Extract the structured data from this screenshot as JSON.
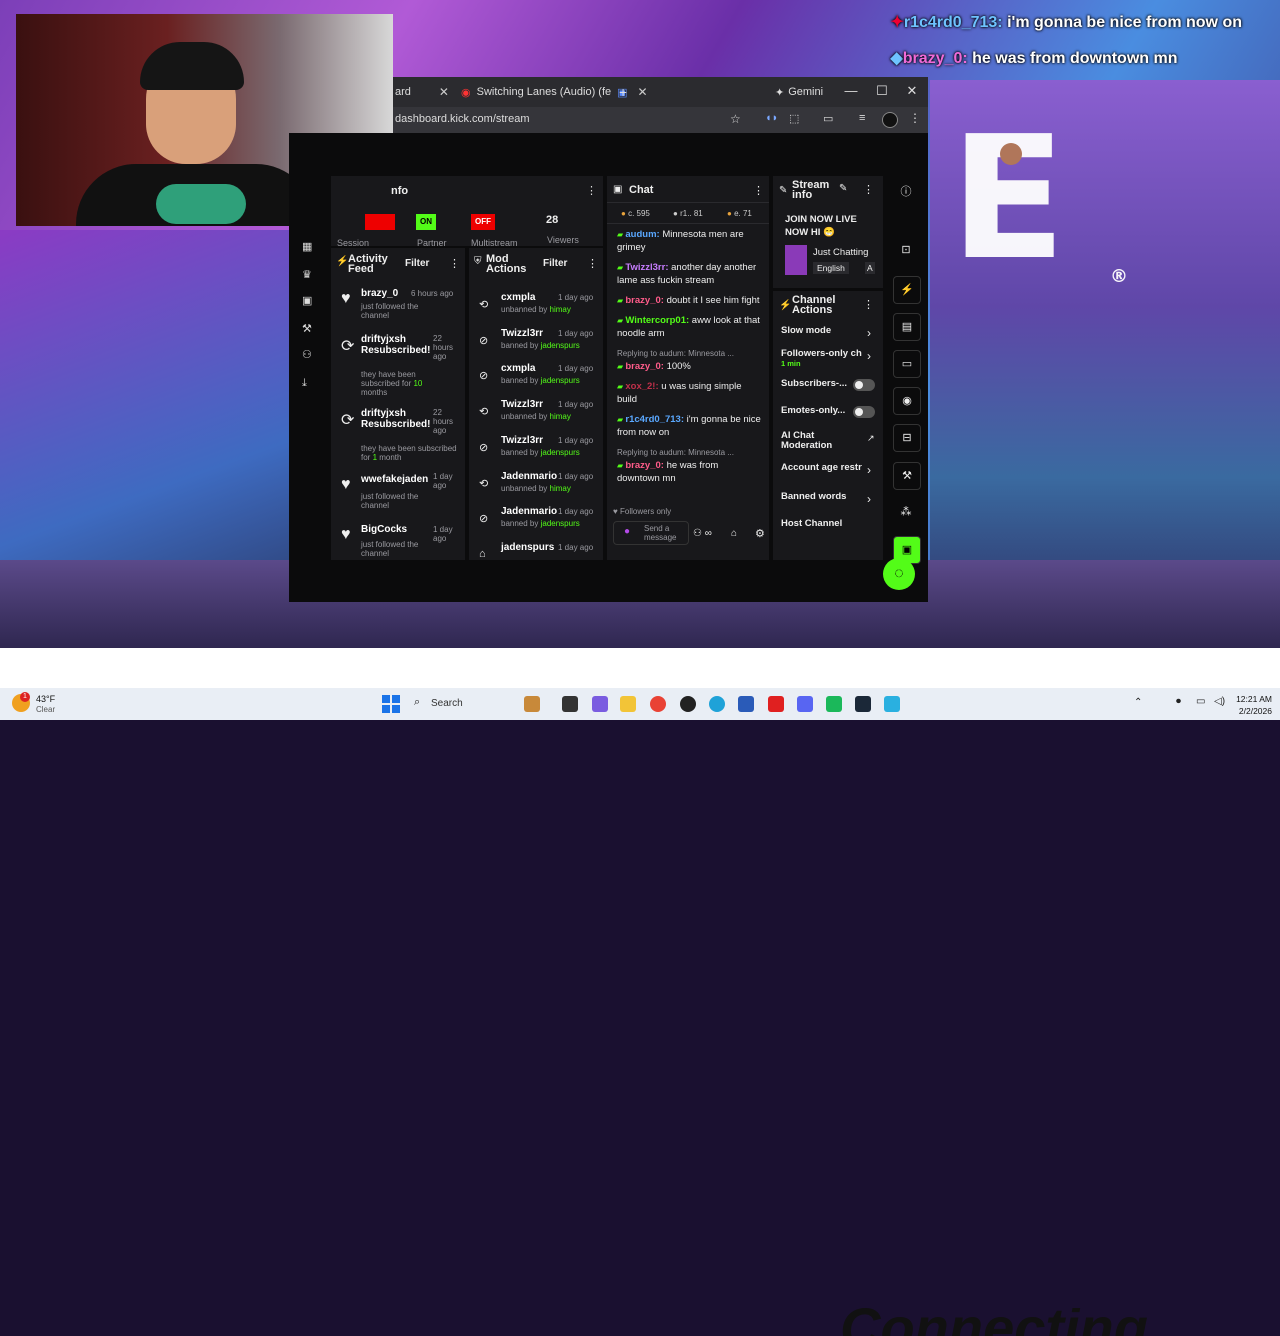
{
  "overlay_chat": [
    {
      "user": "r1c4rd0_713:",
      "text": " i'm gonna be nice from now on"
    },
    {
      "user": "brazy_0:",
      "text": " he was from downtown mn"
    }
  ],
  "background": {
    "caption": "Connecting",
    "registered_mark": "®"
  },
  "browser": {
    "tabs": [
      {
        "label": "ard"
      },
      {
        "label": "Switching Lanes (Audio) (fe"
      },
      {
        "label": "Gemini"
      }
    ],
    "new_tab": "+",
    "url": "dashboard.kick.com/stream"
  },
  "session_info": {
    "title": "nfo",
    "cells": [
      {
        "label": "Session",
        "badge": ""
      },
      {
        "label": "Partner",
        "badge": "ON"
      },
      {
        "label": "Multistream",
        "badge": "OFF"
      },
      {
        "label": "Viewers",
        "value": "28"
      }
    ]
  },
  "activity_feed": {
    "title": "Activity Feed",
    "filter": "Filter",
    "items": [
      {
        "name": "brazy_0",
        "time": "6 hours ago",
        "desc": "just followed the channel"
      },
      {
        "name": "driftyjxsh Resubscribed!",
        "time": "22 hours ago",
        "desc_pre": "they have been subscribed for ",
        "desc_hl": "10",
        "desc_post": " months"
      },
      {
        "name": "driftyjxsh Resubscribed!",
        "time": "22 hours ago",
        "desc_pre": "they have been subscribed for ",
        "desc_hl": "1",
        "desc_post": " month"
      },
      {
        "name": "wwefakejaden",
        "time": "1 day ago",
        "desc": "just followed the channel"
      },
      {
        "name": "BigCocks",
        "time": "1 day ago",
        "desc": "just followed the channel"
      }
    ]
  },
  "mod_actions": {
    "title": "Mod Actions",
    "filter": "Filter",
    "items": [
      {
        "name": "cxmpla",
        "action": "unbanned by ",
        "by": "himay",
        "time": "1 day ago"
      },
      {
        "name": "Twizzl3rr",
        "action": "banned by ",
        "by": "jadenspurs",
        "time": "1 day ago"
      },
      {
        "name": "cxmpla",
        "action": "banned by ",
        "by": "jadenspurs",
        "time": "1 day ago"
      },
      {
        "name": "Twizzl3rr",
        "action": "unbanned by ",
        "by": "himay",
        "time": "1 day ago"
      },
      {
        "name": "Twizzl3rr",
        "action": "banned by ",
        "by": "jadenspurs",
        "time": "1 day ago"
      },
      {
        "name": "Jadenmario",
        "action": "unbanned by ",
        "by": "himay",
        "time": "1 day ago"
      },
      {
        "name": "Jadenmario",
        "action": "banned by ",
        "by": "jadenspurs",
        "time": "1 day ago"
      },
      {
        "name": "jadenspurs",
        "action": "",
        "by": "",
        "time": "1 day ago"
      }
    ]
  },
  "chat": {
    "title": "Chat",
    "stats": [
      "c. 595",
      "r1.. 81",
      "e. 71"
    ],
    "messages": [
      {
        "user": "audum:",
        "text": " Minnesota men are grimey",
        "color": "#5aa8ff"
      },
      {
        "user": "Twizzl3rr:",
        "text": " another day another lame ass fuckin stream",
        "color": "#c77dff"
      },
      {
        "user": "brazy_0:",
        "text": " doubt it I see him fight",
        "color": "#ff5c8a"
      },
      {
        "user": "Wintercorp01:",
        "text": " aww look at that noodle arm",
        "color": "#53fc18"
      },
      {
        "reply": "Replying to audum: Minnesota ...",
        "user": "brazy_0:",
        "text": " 100%",
        "color": "#ff5c8a"
      },
      {
        "user": "xox_2!:",
        "text": " u was using simple build",
        "color": "#c0304a"
      },
      {
        "user": "r1c4rd0_713:",
        "text": " i'm gonna be nice from now on",
        "color": "#5aa8ff"
      },
      {
        "reply": "Replying to audum: Minnesota ...",
        "user": "brazy_0:",
        "text": " he was from downtown mn",
        "color": "#ff5c8a"
      }
    ],
    "followers_only": "Followers only",
    "input_placeholder": "Send a message"
  },
  "stream_info": {
    "title": "Stream info",
    "stream_title": "JOIN NOW LIVE NOW HI 😁",
    "category": "Just Chatting",
    "language": "English",
    "tag_more": "A"
  },
  "channel_actions": {
    "title": "Channel Actions",
    "items": [
      {
        "label": "Slow mode",
        "type": "chevron"
      },
      {
        "label": "Followers-only ch",
        "sub": "1 min",
        "type": "chevron"
      },
      {
        "label": "Subscribers-...",
        "type": "toggle"
      },
      {
        "label": "Emotes-only...",
        "type": "toggle"
      },
      {
        "label": "AI Chat Moderation",
        "type": "external"
      },
      {
        "label": "Account age restr",
        "type": "chevron"
      },
      {
        "label": "Banned words",
        "type": "chevron"
      },
      {
        "label": "Host Channel",
        "type": "none"
      }
    ]
  },
  "taskbar": {
    "weather_temp": "43°F",
    "weather_desc": "Clear",
    "weather_badge": "1",
    "search_placeholder": "Search",
    "time": "12:21 AM",
    "date": "2/2/2026"
  }
}
